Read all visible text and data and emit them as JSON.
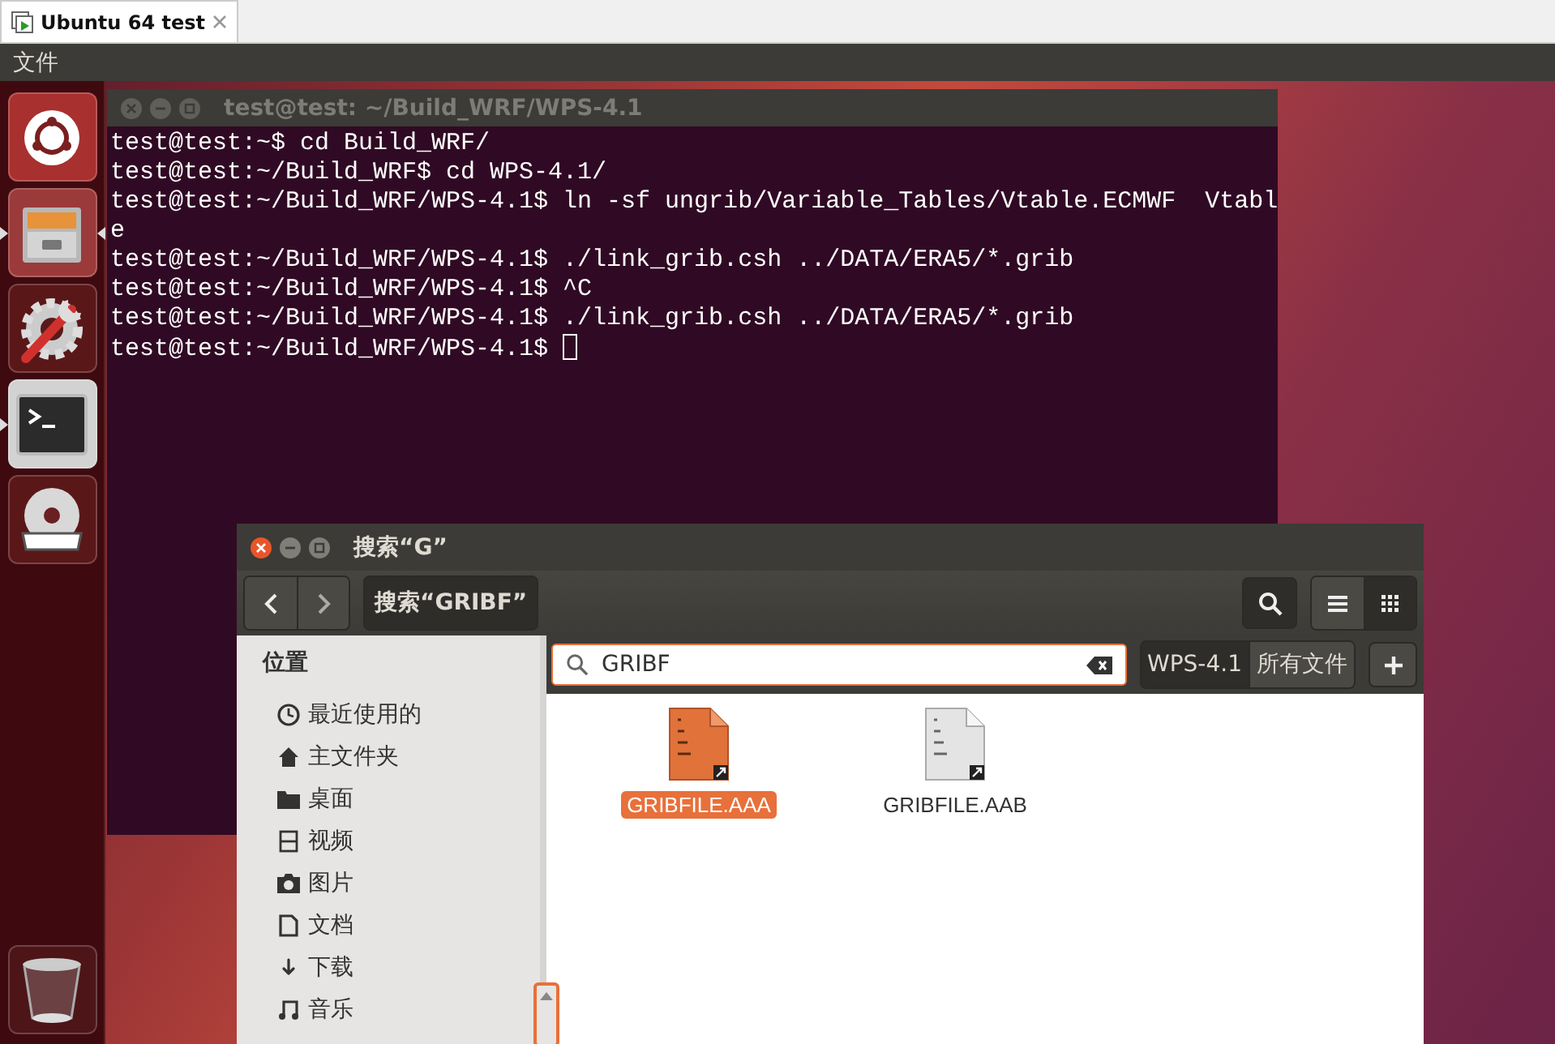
{
  "vm_tab": {
    "title": "Ubuntu 64 test"
  },
  "menu_bar": [
    "文件"
  ],
  "launcher": [
    {
      "kind": "dash",
      "running": false,
      "focused": false
    },
    {
      "kind": "files",
      "running": true,
      "focused": true
    },
    {
      "kind": "settings",
      "running": false,
      "focused": false
    },
    {
      "kind": "terminal",
      "running": true,
      "focused": false
    },
    {
      "kind": "dvd",
      "running": false,
      "focused": false
    },
    {
      "kind": "trash",
      "running": false,
      "focused": false
    }
  ],
  "terminal": {
    "title": "test@test: ~/Build_WRF/WPS-4.1",
    "focused": false,
    "lines": [
      "test@test:~$ cd Build_WRF/",
      "test@test:~/Build_WRF$ cd WPS-4.1/",
      "test@test:~/Build_WRF/WPS-4.1$ ln -sf ungrib/Variable_Tables/Vtable.ECMWF  Vtabl",
      "e",
      "test@test:~/Build_WRF/WPS-4.1$ ./link_grib.csh ../DATA/ERA5/*.grib",
      "test@test:~/Build_WRF/WPS-4.1$ ^C",
      "test@test:~/Build_WRF/WPS-4.1$ ./link_grib.csh ../DATA/ERA5/*.grib",
      "test@test:~/Build_WRF/WPS-4.1$ "
    ]
  },
  "file_manager": {
    "title": "搜索“G”",
    "focused": true,
    "path_button": "搜索“GRIBF”",
    "view_modes": [
      {
        "kind": "list",
        "selected": false
      },
      {
        "kind": "grid",
        "selected": true
      }
    ],
    "search": {
      "value": "GRIBF"
    },
    "scope": [
      {
        "label": "WPS-4.1",
        "selected": true
      },
      {
        "label": "所有文件",
        "selected": false
      }
    ],
    "sidebar": {
      "heading": "位置",
      "items": [
        {
          "kind": "recent",
          "label": "最近使用的"
        },
        {
          "kind": "home",
          "label": "主文件夹"
        },
        {
          "kind": "desktop",
          "label": "桌面"
        },
        {
          "kind": "videos",
          "label": "视频"
        },
        {
          "kind": "pictures",
          "label": "图片"
        },
        {
          "kind": "documents",
          "label": "文档"
        },
        {
          "kind": "downloads",
          "label": "下载"
        },
        {
          "kind": "music",
          "label": "音乐"
        }
      ]
    },
    "files": [
      {
        "name": "GRIBFILE.AAA",
        "selected": true
      },
      {
        "name": "GRIBFILE.AAB",
        "selected": false
      }
    ]
  }
}
